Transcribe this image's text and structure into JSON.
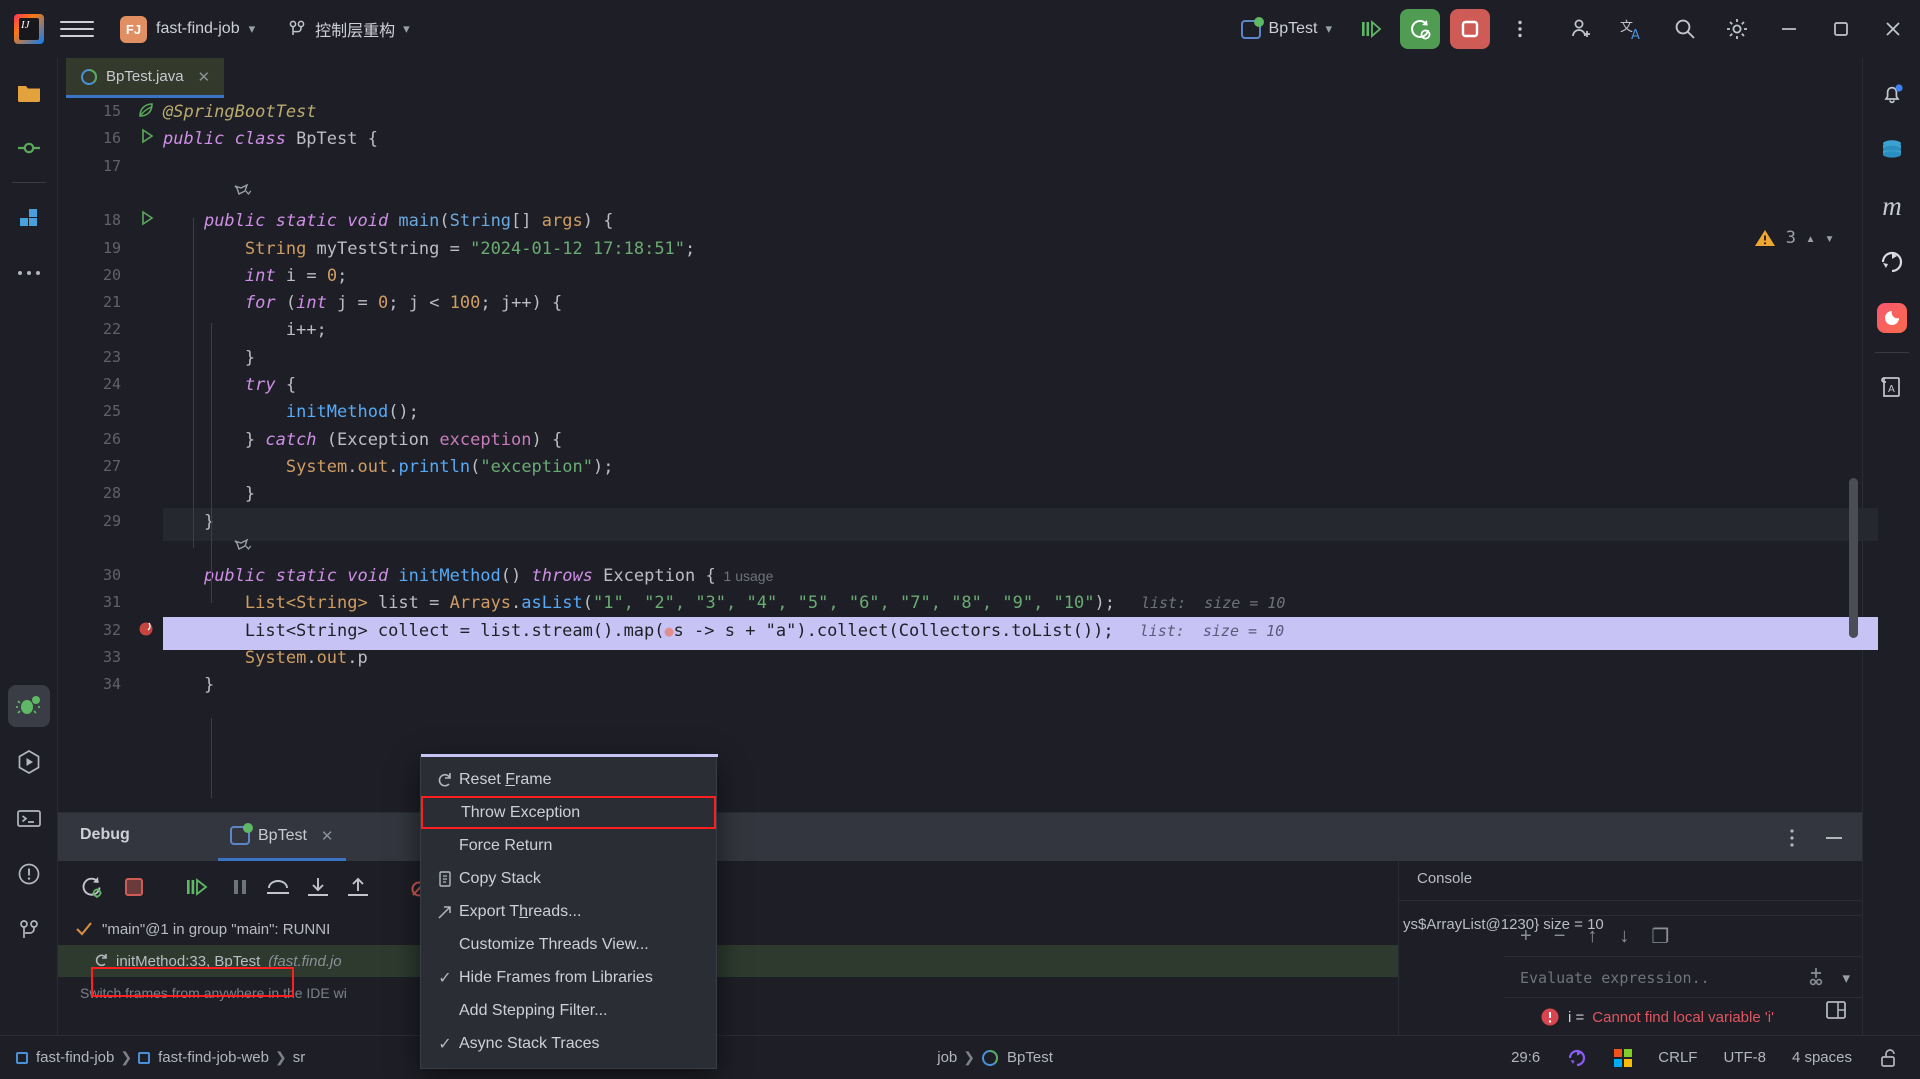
{
  "titlebar": {
    "logo_name": "intellij-idea-logo",
    "menu_icon": "hamburger-menu-icon",
    "project_badge": "FJ",
    "project_name": "fast-find-job",
    "branch_icon": "branch-icon",
    "branch_name": "控制层重构",
    "run_config": "BpTest",
    "run_icon": "run-to-cursor-icon",
    "debug_button": "rerun-debug-icon",
    "stop_button": "stop-icon",
    "more_button": "more-vertical-icon",
    "add_user": "add-user-icon",
    "translate": "translate-icon",
    "search": "search-icon",
    "settings": "gear-icon",
    "minimize": "minimize-icon",
    "maximize": "maximize-icon",
    "close": "close-icon"
  },
  "left_rail": [
    {
      "name": "project-icon",
      "label": "Project"
    },
    {
      "name": "commit-icon",
      "label": "Commit"
    },
    {
      "name": "plugins-icon",
      "label": "Plugins"
    },
    {
      "name": "more-tools-icon",
      "label": "More"
    },
    {
      "name": "debug-icon",
      "label": "Debug"
    },
    {
      "name": "run-icon",
      "label": "Run"
    },
    {
      "name": "terminal-icon",
      "label": "Terminal"
    },
    {
      "name": "problems-icon",
      "label": "Problems"
    },
    {
      "name": "version-control-icon",
      "label": "Version Control"
    }
  ],
  "right_rail": [
    {
      "name": "notifications-icon",
      "label": "Notifications"
    },
    {
      "name": "database-icon",
      "label": "Database"
    },
    {
      "name": "maven-icon",
      "label": "Maven"
    },
    {
      "name": "spring-icon",
      "label": "Spring"
    },
    {
      "name": "codegeex-icon",
      "label": "AI Assistant"
    },
    {
      "name": "dictionary-icon",
      "label": "Translation"
    }
  ],
  "editor": {
    "tab": {
      "label": "BpTest.java",
      "icon": "java-class-icon",
      "close": "close-icon"
    },
    "warning_count": "3",
    "warning_icon": "warning-triangle-icon",
    "nav_up": "chevron-up-icon",
    "nav_down": "chevron-down-icon",
    "lines": [
      {
        "no": "15",
        "gutter": "spring-leaf-icon",
        "segs": [
          {
            "t": "@SpringBootTest",
            "c": "an"
          }
        ]
      },
      {
        "no": "16",
        "gutter": "run-gutter-icon",
        "segs": [
          {
            "t": "public class ",
            "c": "k"
          },
          {
            "t": "BpTest ",
            "c": "id"
          },
          {
            "t": "{",
            "c": "pl"
          }
        ]
      },
      {
        "no": "17",
        "gutter": "",
        "segs": []
      },
      {
        "no": "",
        "gutter": "",
        "segs": [
          {
            "t": "    ",
            "c": "pl"
          }
        ],
        "fold": "spring-bean-icon"
      },
      {
        "no": "18",
        "gutter": "run-gutter-icon",
        "segs": [
          {
            "t": "    ",
            "c": "pl"
          },
          {
            "t": "public static void ",
            "c": "k"
          },
          {
            "t": "main",
            "c": "ty"
          },
          {
            "t": "(",
            "c": "pl"
          },
          {
            "t": "String",
            "c": "ty"
          },
          {
            "t": "[] ",
            "c": "pl"
          },
          {
            "t": "args",
            "c": "num"
          },
          {
            "t": ") {",
            "c": "pl"
          }
        ]
      },
      {
        "no": "19",
        "gutter": "",
        "segs": [
          {
            "t": "        ",
            "c": "pl"
          },
          {
            "t": "String ",
            "c": "num"
          },
          {
            "t": "myTestString ",
            "c": "id"
          },
          {
            "t": "= ",
            "c": "pl"
          },
          {
            "t": "\"2024-01-12 17:18:51\"",
            "c": "str"
          },
          {
            "t": ";",
            "c": "pl"
          }
        ]
      },
      {
        "no": "20",
        "gutter": "",
        "segs": [
          {
            "t": "        ",
            "c": "pl"
          },
          {
            "t": "int ",
            "c": "k"
          },
          {
            "t": "i ",
            "c": "id"
          },
          {
            "t": "= ",
            "c": "pl"
          },
          {
            "t": "0",
            "c": "num"
          },
          {
            "t": ";",
            "c": "pl"
          }
        ]
      },
      {
        "no": "21",
        "gutter": "",
        "segs": [
          {
            "t": "        ",
            "c": "pl"
          },
          {
            "t": "for ",
            "c": "k"
          },
          {
            "t": "(",
            "c": "pl"
          },
          {
            "t": "int ",
            "c": "k"
          },
          {
            "t": "j ",
            "c": "id"
          },
          {
            "t": "= ",
            "c": "pl"
          },
          {
            "t": "0",
            "c": "num"
          },
          {
            "t": "; j < ",
            "c": "pl"
          },
          {
            "t": "100",
            "c": "num"
          },
          {
            "t": "; j++) {",
            "c": "pl"
          }
        ]
      },
      {
        "no": "22",
        "gutter": "",
        "segs": [
          {
            "t": "            i++;",
            "c": "pl"
          }
        ]
      },
      {
        "no": "23",
        "gutter": "",
        "segs": [
          {
            "t": "        }",
            "c": "pl"
          }
        ]
      },
      {
        "no": "24",
        "gutter": "",
        "segs": [
          {
            "t": "        ",
            "c": "pl"
          },
          {
            "t": "try ",
            "c": "k"
          },
          {
            "t": "{",
            "c": "pl"
          }
        ]
      },
      {
        "no": "25",
        "gutter": "",
        "segs": [
          {
            "t": "            ",
            "c": "pl"
          },
          {
            "t": "initMethod",
            "c": "mth"
          },
          {
            "t": "();",
            "c": "pl"
          }
        ]
      },
      {
        "no": "26",
        "gutter": "",
        "segs": [
          {
            "t": "        } ",
            "c": "pl"
          },
          {
            "t": "catch ",
            "c": "k"
          },
          {
            "t": "(Exception ",
            "c": "pl"
          },
          {
            "t": "exception",
            "c": "fld"
          },
          {
            "t": ") {",
            "c": "pl"
          }
        ]
      },
      {
        "no": "27",
        "gutter": "",
        "segs": [
          {
            "t": "            ",
            "c": "pl"
          },
          {
            "t": "System",
            "c": "num"
          },
          {
            "t": ".",
            "c": "pl"
          },
          {
            "t": "out",
            "c": "num"
          },
          {
            "t": ".",
            "c": "pl"
          },
          {
            "t": "println",
            "c": "mth"
          },
          {
            "t": "(",
            "c": "pl"
          },
          {
            "t": "\"exception\"",
            "c": "str"
          },
          {
            "t": ");",
            "c": "pl"
          }
        ]
      },
      {
        "no": "28",
        "gutter": "",
        "segs": [
          {
            "t": "        }",
            "c": "pl"
          }
        ]
      },
      {
        "no": "29",
        "gutter": "",
        "segs": [
          {
            "t": "    }",
            "c": "pl"
          }
        ],
        "current": true
      },
      {
        "no": "",
        "gutter": "",
        "segs": [],
        "fold": "spring-bean-icon"
      },
      {
        "no": "30",
        "gutter": "",
        "segs": [
          {
            "t": "    ",
            "c": "pl"
          },
          {
            "t": "public static void ",
            "c": "k"
          },
          {
            "t": "initMethod",
            "c": "mth"
          },
          {
            "t": "() ",
            "c": "pl"
          },
          {
            "t": "throws ",
            "c": "k"
          },
          {
            "t": "Exception {",
            "c": "pl"
          }
        ],
        "usage": "1 usage"
      },
      {
        "no": "31",
        "gutter": "",
        "segs": [
          {
            "t": "        ",
            "c": "pl"
          },
          {
            "t": "List<String> ",
            "c": "num"
          },
          {
            "t": "list ",
            "c": "id"
          },
          {
            "t": "= ",
            "c": "pl"
          },
          {
            "t": "Arrays",
            "c": "num"
          },
          {
            "t": ".",
            "c": "pl"
          },
          {
            "t": "asList",
            "c": "mth"
          },
          {
            "t": "(",
            "c": "pl"
          },
          {
            "t": "\"1\", \"2\", \"3\", \"4\", \"5\", \"6\", \"7\", \"8\", \"9\", \"10\"",
            "c": "str"
          },
          {
            "t": ");",
            "c": "pl"
          }
        ],
        "hint": "list:  size = 10"
      },
      {
        "no": "32",
        "gutter": "breakpoint-icon",
        "highlight": true,
        "segs": [
          {
            "t": "        List<String> collect = list.stream().map(",
            "c": "dk"
          },
          {
            "t": "●",
            "c": "bp"
          },
          {
            "t": "s -> s + \"a\").collect(Collectors.toList());",
            "c": "dk"
          }
        ],
        "hint": "list:  size = 10"
      },
      {
        "no": "33",
        "gutter": "",
        "segs": [
          {
            "t": "        ",
            "c": "pl"
          },
          {
            "t": "System",
            "c": "num"
          },
          {
            "t": ".",
            "c": "pl"
          },
          {
            "t": "out",
            "c": "num"
          },
          {
            "t": ".p",
            "c": "pl"
          }
        ]
      },
      {
        "no": "34",
        "gutter": "",
        "segs": [
          {
            "t": "    }",
            "c": "pl"
          }
        ]
      }
    ]
  },
  "context_menu": {
    "items": [
      {
        "label": "Reset Frame",
        "icon": "reset-frame-icon",
        "check": false,
        "boxed": false,
        "mnemonic": "F"
      },
      {
        "label": "Throw Exception",
        "icon": "",
        "check": false,
        "boxed": true,
        "mnemonic": ""
      },
      {
        "label": "Force Return",
        "icon": "",
        "check": false,
        "boxed": false,
        "mnemonic": ""
      },
      {
        "label": "Copy Stack",
        "icon": "copy-stack-icon",
        "check": false,
        "boxed": false,
        "mnemonic": ""
      },
      {
        "label": "Export Threads...",
        "icon": "export-threads-icon",
        "check": false,
        "boxed": false,
        "mnemonic": "h"
      },
      {
        "label": "Customize Threads View...",
        "icon": "",
        "check": false,
        "boxed": false,
        "mnemonic": ""
      },
      {
        "label": "Hide Frames from Libraries",
        "icon": "",
        "check": true,
        "boxed": false,
        "mnemonic": ""
      },
      {
        "label": "Add Stepping Filter...",
        "icon": "",
        "check": false,
        "boxed": false,
        "mnemonic": ""
      },
      {
        "label": "Async Stack Traces",
        "icon": "",
        "check": true,
        "boxed": false,
        "mnemonic": ""
      }
    ]
  },
  "debug": {
    "title": "Debug",
    "tab_label": "BpTest",
    "tab_icon": "run-config-icon",
    "tab_close": "close-icon",
    "options_icon": "more-vertical-icon",
    "hide_icon": "minimize-icon",
    "toolbar": [
      {
        "name": "rerun-debug-icon"
      },
      {
        "name": "stop-icon"
      },
      {
        "name": "resume-program-icon"
      },
      {
        "name": "pause-program-icon"
      },
      {
        "name": "step-over-icon"
      },
      {
        "name": "step-into-icon"
      },
      {
        "name": "step-out-icon"
      },
      {
        "name": "mute-breakpoints-icon"
      }
    ],
    "threads": [
      {
        "text": "\"main\"@1 in group \"main\": RUNNI",
        "icon": "thread-check-icon",
        "selected": false
      },
      {
        "text": "initMethod:33, BpTest",
        "sub": "(fast.find.jo",
        "icon": "frame-icon",
        "selected": true,
        "boxed": true
      }
    ],
    "hint": "Switch frames from anywhere in the IDE wi",
    "variables_tabs": [
      {
        "label": "Console",
        "name": "tab-console"
      }
    ],
    "variable_row": "ys$ArrayList@1230}  size = 10",
    "layout_icon": "layout-settings-icon"
  },
  "evaluate": {
    "toolbar": [
      {
        "name": "add-watch-icon",
        "glyph": "+"
      },
      {
        "name": "remove-watch-icon",
        "glyph": "−"
      },
      {
        "name": "move-up-icon",
        "glyph": "↑"
      },
      {
        "name": "move-down-icon",
        "glyph": "↓"
      },
      {
        "name": "copy-value-icon",
        "glyph": "❐"
      }
    ],
    "placeholder": "Evaluate expression..",
    "expand_icon": "chevron-down-icon",
    "eval_icon": "evaluate-icon",
    "error_icon": "error-circle-icon",
    "error_prefix": "i = ",
    "error_text": "Cannot find local variable 'i'"
  },
  "status": {
    "breadcrumbs": [
      {
        "label": "fast-find-job",
        "icon": "module-icon"
      },
      {
        "label": "fast-find-job-web",
        "icon": "module-icon"
      },
      {
        "label": "sr",
        "icon": ""
      },
      {
        "label": "job",
        "icon": ""
      },
      {
        "label": "BpTest",
        "icon": "java-class-icon"
      }
    ],
    "caret": "29:6",
    "spring_icon": "spring-icon",
    "ms_icon": "windows-icon",
    "line_sep": "CRLF",
    "encoding": "UTF-8",
    "indent": "4 spaces",
    "lock_icon": "unlocked-icon"
  },
  "colors": {
    "bg": "#1e1f26",
    "panel": "#33363e",
    "accent_blue": "#3b74c4",
    "green": "#4f9c52",
    "red": "#cf5b56",
    "highlight_line": "#c8c3f5",
    "error_red": "#e05561",
    "warn_orange": "#f0a732",
    "red_box": "#ff1f1f"
  }
}
